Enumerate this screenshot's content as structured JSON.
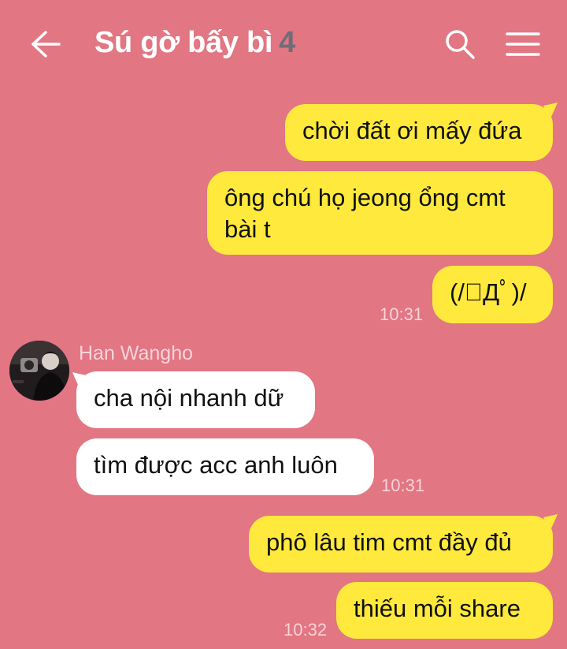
{
  "header": {
    "title": "Sú gờ bấy bì",
    "member_count": "4"
  },
  "messages": {
    "m1": "chời đất ơi mấy đứa",
    "m2": "ông chú họ jeong ổng cmt bài t",
    "m3": "(/ﾟДﾟ)/",
    "t1": "10:31",
    "sender": "Han Wangho",
    "m4": "cha nội nhanh dữ",
    "m5": "tìm được acc anh luôn",
    "t2": "10:31",
    "m6": "phô lâu tim cmt đầy đủ",
    "m7": "thiếu mỗi share",
    "t3": "10:32"
  },
  "colors": {
    "background": "#e27683",
    "my_bubble": "#ffe93d",
    "other_bubble": "#ffffff",
    "count": "#6e6d78"
  },
  "icons": [
    "back-arrow-icon",
    "search-icon",
    "menu-icon"
  ]
}
